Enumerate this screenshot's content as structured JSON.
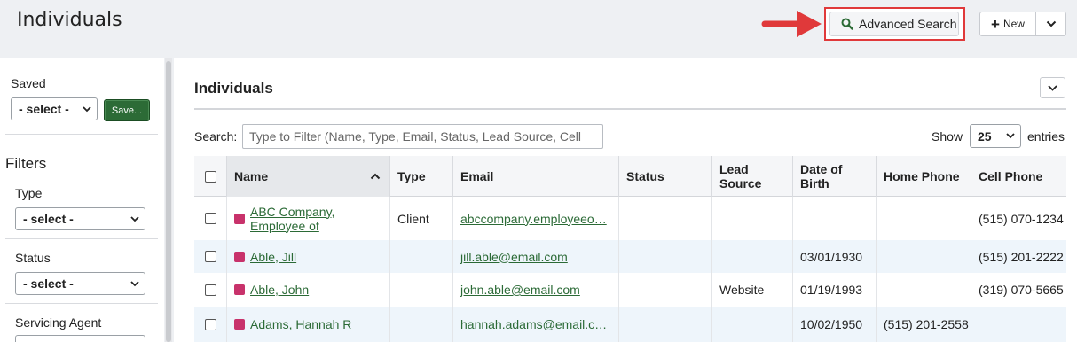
{
  "header": {
    "title": "Individuals",
    "advanced_search_label": "Advanced Search",
    "new_label": "New"
  },
  "sidebar": {
    "saved_label": "Saved",
    "saved_select_value": "- select -",
    "save_button_label": "Save...",
    "filters_title": "Filters",
    "filters": [
      {
        "label": "Type",
        "value": "- select -"
      },
      {
        "label": "Status",
        "value": "- select -"
      },
      {
        "label": "Servicing Agent",
        "value": ""
      }
    ]
  },
  "main": {
    "section_title": "Individuals",
    "search_label": "Search:",
    "search_placeholder": "Type to Filter (Name, Type, Email, Status, Lead Source, Cell",
    "show_label": "Show",
    "entries_value": "25",
    "entries_label": "entries",
    "columns": [
      "Name",
      "Type",
      "Email",
      "Status",
      "Lead Source",
      "Date of Birth",
      "Home Phone",
      "Cell Phone"
    ],
    "rows": [
      {
        "name": "ABC Company, Employee of",
        "type": "Client",
        "email": "abccompany.employeeo…",
        "status": "",
        "lead_source": "",
        "dob": "",
        "home_phone": "",
        "cell_phone": "(515) 070-1234"
      },
      {
        "name": "Able, Jill",
        "type": "",
        "email": "jill.able@email.com",
        "status": "",
        "lead_source": "",
        "dob": "03/01/1930",
        "home_phone": "",
        "cell_phone": "(515) 201-2222"
      },
      {
        "name": "Able, John",
        "type": "",
        "email": "john.able@email.com",
        "status": "",
        "lead_source": "Website",
        "dob": "01/19/1993",
        "home_phone": "",
        "cell_phone": "(319) 070-5665"
      },
      {
        "name": "Adams, Hannah R",
        "type": "",
        "email": "hannah.adams@email.c…",
        "status": "",
        "lead_source": "",
        "dob": "10/02/1950",
        "home_phone": "(515) 201-2558",
        "cell_phone": ""
      }
    ]
  },
  "colors": {
    "accent_green": "#2c6b36",
    "link_green": "#2b6a36",
    "highlight_red": "#e0393a",
    "record_marker": "#c8326b"
  }
}
